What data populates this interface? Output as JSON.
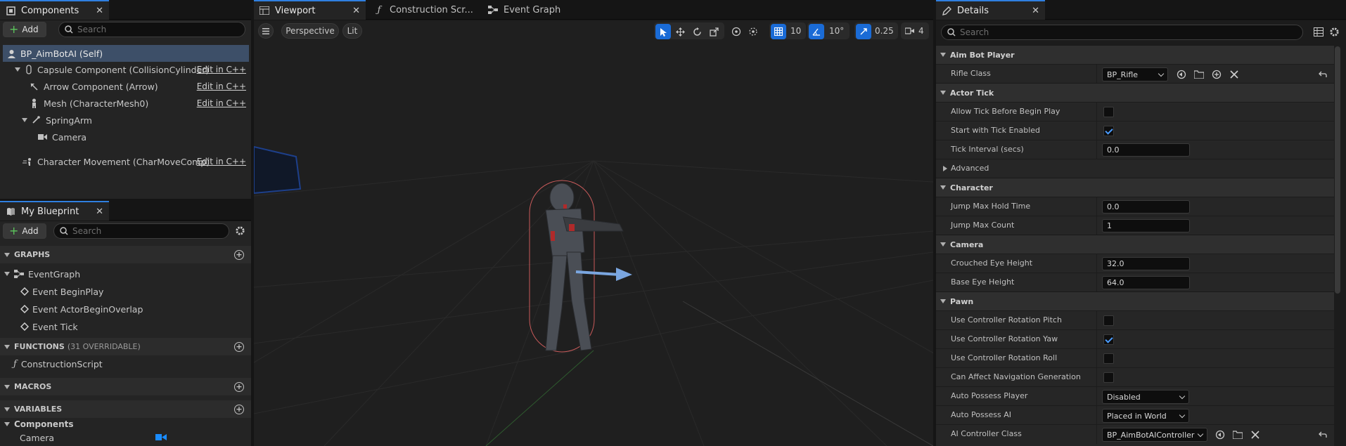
{
  "components_panel": {
    "tab_label": "Components",
    "add_label": "Add",
    "search_placeholder": "Search",
    "root": "BP_AimBotAI (Self)",
    "items": [
      {
        "label": "Capsule Component (CollisionCylinder)",
        "edit": "Edit in C++"
      },
      {
        "label": "Arrow Component (Arrow)",
        "edit": "Edit in C++"
      },
      {
        "label": "Mesh (CharacterMesh0)",
        "edit": "Edit in C++"
      },
      {
        "label": "SpringArm",
        "edit": ""
      },
      {
        "label": "Camera",
        "edit": ""
      },
      {
        "label": "Character Movement (CharMoveComp)",
        "edit": "Edit in C++"
      }
    ]
  },
  "blueprint_panel": {
    "tab_label": "My Blueprint",
    "add_label": "Add",
    "search_placeholder": "Search",
    "graphs_label": "GRAPHS",
    "event_graph": "EventGraph",
    "events": [
      "Event BeginPlay",
      "Event ActorBeginOverlap",
      "Event Tick"
    ],
    "functions_label": "FUNCTIONS",
    "functions_count": "(31 OVERRIDABLE)",
    "construction_script": "ConstructionScript",
    "macros_label": "MACROS",
    "variables_label": "VARIABLES",
    "components_group": "Components",
    "camera_var": "Camera"
  },
  "center_tabs": {
    "viewport": "Viewport",
    "construction": "Construction Scr...",
    "event_graph": "Event Graph"
  },
  "viewport": {
    "perspective": "Perspective",
    "lit": "Lit",
    "grid_snap": "10",
    "rot_snap": "10°",
    "scale_snap": "0.25",
    "cam_speed": "4"
  },
  "details": {
    "tab_label": "Details",
    "search_placeholder": "Search",
    "categories": {
      "aim": "Aim Bot Player",
      "actor_tick": "Actor Tick",
      "character": "Character",
      "camera": "Camera",
      "pawn": "Pawn"
    },
    "rifle_class_label": "Rifle Class",
    "rifle_class_value": "BP_Rifle",
    "allow_tick_label": "Allow Tick Before Begin Play",
    "start_tick_label": "Start with Tick Enabled",
    "tick_interval_label": "Tick Interval (secs)",
    "tick_interval_value": "0.0",
    "advanced_label": "Advanced",
    "jump_hold_label": "Jump Max Hold Time",
    "jump_hold_value": "0.0",
    "jump_count_label": "Jump Max Count",
    "jump_count_value": "1",
    "crouched_eye_label": "Crouched Eye Height",
    "crouched_eye_value": "32.0",
    "base_eye_label": "Base Eye Height",
    "base_eye_value": "64.0",
    "pitch_label": "Use Controller Rotation Pitch",
    "yaw_label": "Use Controller Rotation Yaw",
    "roll_label": "Use Controller Rotation Roll",
    "nav_label": "Can Affect Navigation Generation",
    "auto_possess_player_label": "Auto Possess Player",
    "auto_possess_player_value": "Disabled",
    "auto_possess_ai_label": "Auto Possess AI",
    "auto_possess_ai_value": "Placed in World",
    "ai_controller_label": "AI Controller Class",
    "ai_controller_value": "BP_AimBotAIController"
  },
  "colors": {
    "accent": "#2f7fe0",
    "selected_row": "#3d4f68",
    "panel": "#242424",
    "viewport_bg": "#1e1e1e"
  }
}
